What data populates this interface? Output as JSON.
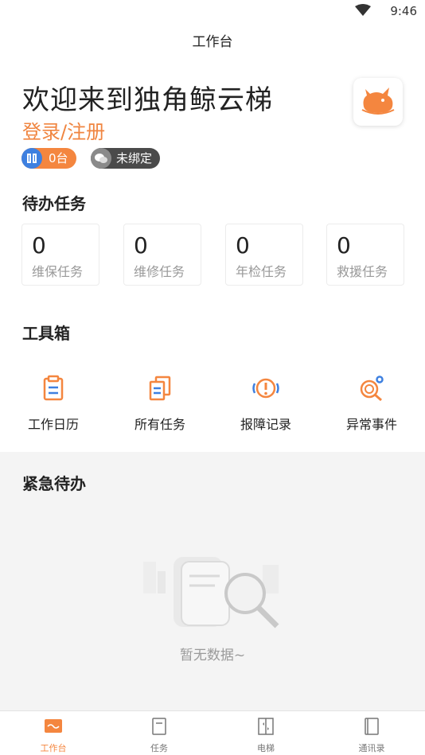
{
  "status_bar": {
    "time": "9:46"
  },
  "header": {
    "title": "工作台"
  },
  "welcome": {
    "title": "欢迎来到独角鲸云梯",
    "login_link": "登录/注册"
  },
  "badges": {
    "elevator_count": "0台",
    "wechat_status": "未绑定"
  },
  "pending": {
    "title": "待办任务",
    "items": [
      {
        "count": "0",
        "label": "维保任务"
      },
      {
        "count": "0",
        "label": "维修任务"
      },
      {
        "count": "0",
        "label": "年检任务"
      },
      {
        "count": "0",
        "label": "救援任务"
      }
    ]
  },
  "toolbox": {
    "title": "工具箱",
    "items": [
      {
        "label": "工作日历",
        "icon": "clipboard-icon"
      },
      {
        "label": "所有任务",
        "icon": "documents-icon"
      },
      {
        "label": "报障记录",
        "icon": "alert-icon"
      },
      {
        "label": "异常事件",
        "icon": "anomaly-search-icon"
      }
    ]
  },
  "urgent": {
    "title": "紧急待办",
    "empty_text": "暂无数据~"
  },
  "tabbar": {
    "items": [
      {
        "label": "工作台",
        "active": true
      },
      {
        "label": "任务",
        "active": false
      },
      {
        "label": "电梯",
        "active": false
      },
      {
        "label": "通讯录",
        "active": false
      }
    ]
  },
  "colors": {
    "accent": "#f4863f",
    "blue": "#3e80e0"
  }
}
